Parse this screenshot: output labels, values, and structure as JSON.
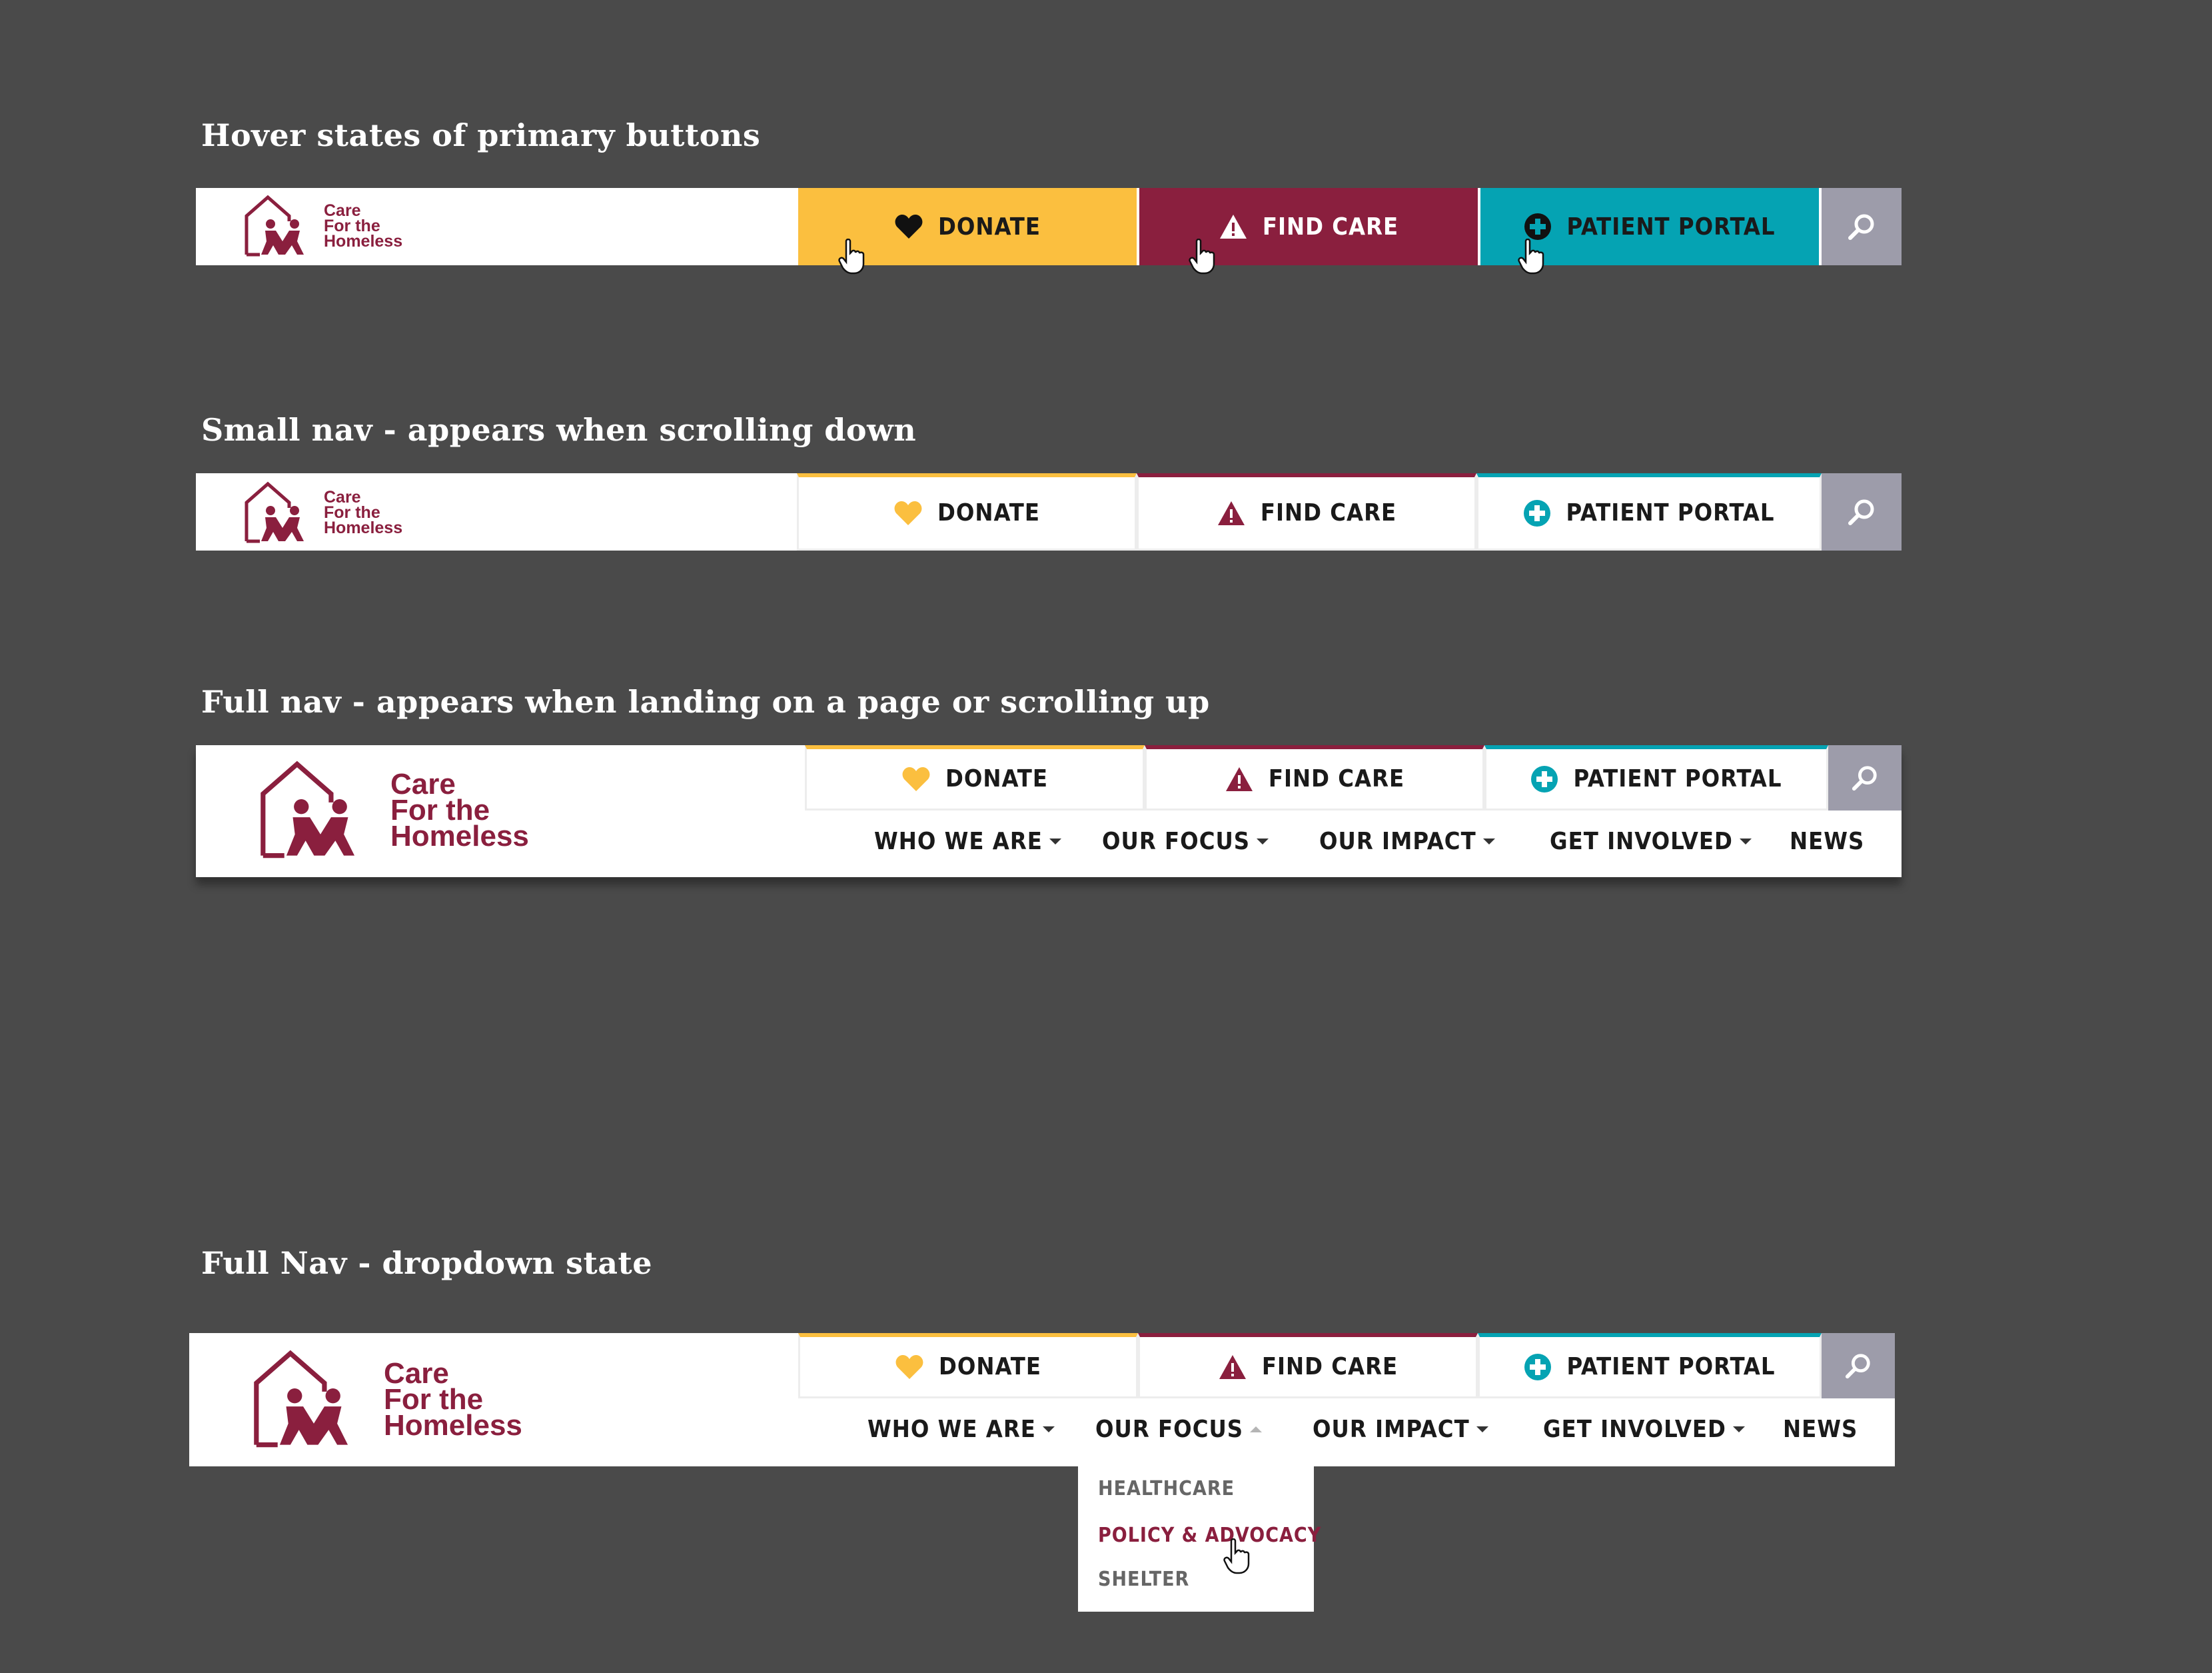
{
  "sections": {
    "hover": "Hover states of primary buttons",
    "small": "Small nav - appears when scrolling down",
    "full": "Full nav - appears when landing on a page or scrolling up",
    "dropdown": "Full Nav - dropdown state"
  },
  "brand": {
    "line1": "Care",
    "line2": "For the",
    "line3": "Homeless"
  },
  "buttons": {
    "donate": "DONATE",
    "find_care": "FIND CARE",
    "patient_portal": "PATIENT PORTAL"
  },
  "menu": {
    "who_we_are": "WHO WE ARE",
    "our_focus": "OUR FOCUS",
    "our_impact": "OUR IMPACT",
    "get_involved": "GET INVOLVED",
    "news": "NEWS"
  },
  "dropdown": {
    "items": [
      "HEALTHCARE",
      "POLICY & ADVOCACY",
      "SHELTER"
    ]
  },
  "colors": {
    "donate": "#fbbf3f",
    "find_care": "#8a1f3e",
    "patient_portal": "#05a3b3",
    "search": "#9d9caa",
    "background": "#4a4a4a"
  },
  "icons": [
    "heart-icon",
    "warning-icon",
    "plus-circle-icon",
    "search-icon",
    "hand-cursor-icon"
  ]
}
